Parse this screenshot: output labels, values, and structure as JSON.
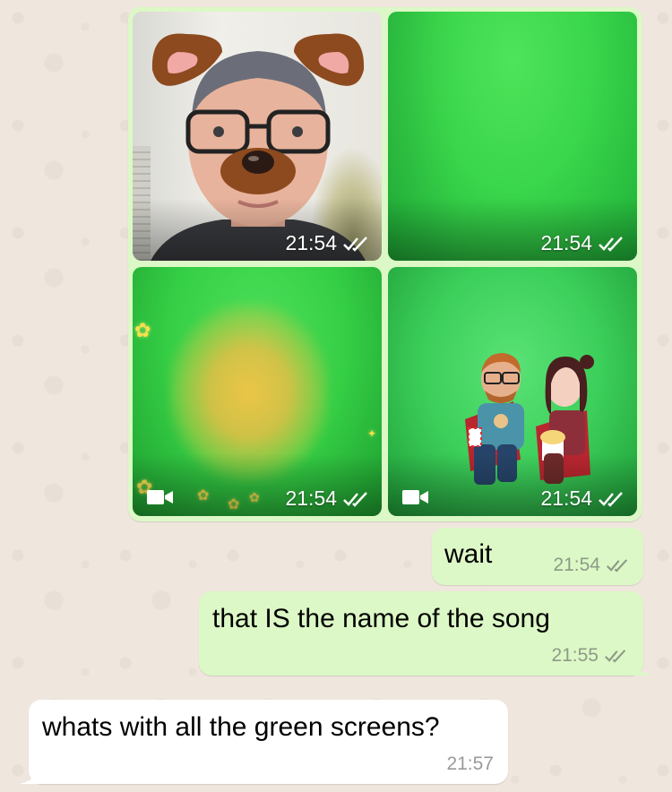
{
  "media_grid": {
    "tiles": [
      {
        "time": "21:54",
        "is_video": false,
        "status": "double-check-read"
      },
      {
        "time": "21:54",
        "is_video": false,
        "status": "double-check-read"
      },
      {
        "time": "21:54",
        "is_video": true,
        "status": "double-check-read"
      },
      {
        "time": "21:54",
        "is_video": true,
        "status": "double-check-read"
      }
    ]
  },
  "messages": [
    {
      "direction": "outgoing",
      "text": "wait",
      "time": "21:54",
      "status": "double-check"
    },
    {
      "direction": "outgoing",
      "text": "that IS the name of the song",
      "time": "21:55",
      "status": "double-check"
    },
    {
      "direction": "incoming",
      "text": "whats with all the green screens?",
      "time": "21:57"
    }
  ],
  "colors": {
    "outgoing_bubble": "#dcf8c6",
    "incoming_bubble": "#ffffff",
    "wallpaper": "#efe7de",
    "green_screen": "#3ad64b"
  },
  "icons": {
    "video": "video-camera-icon",
    "status": "double-check-icon"
  }
}
